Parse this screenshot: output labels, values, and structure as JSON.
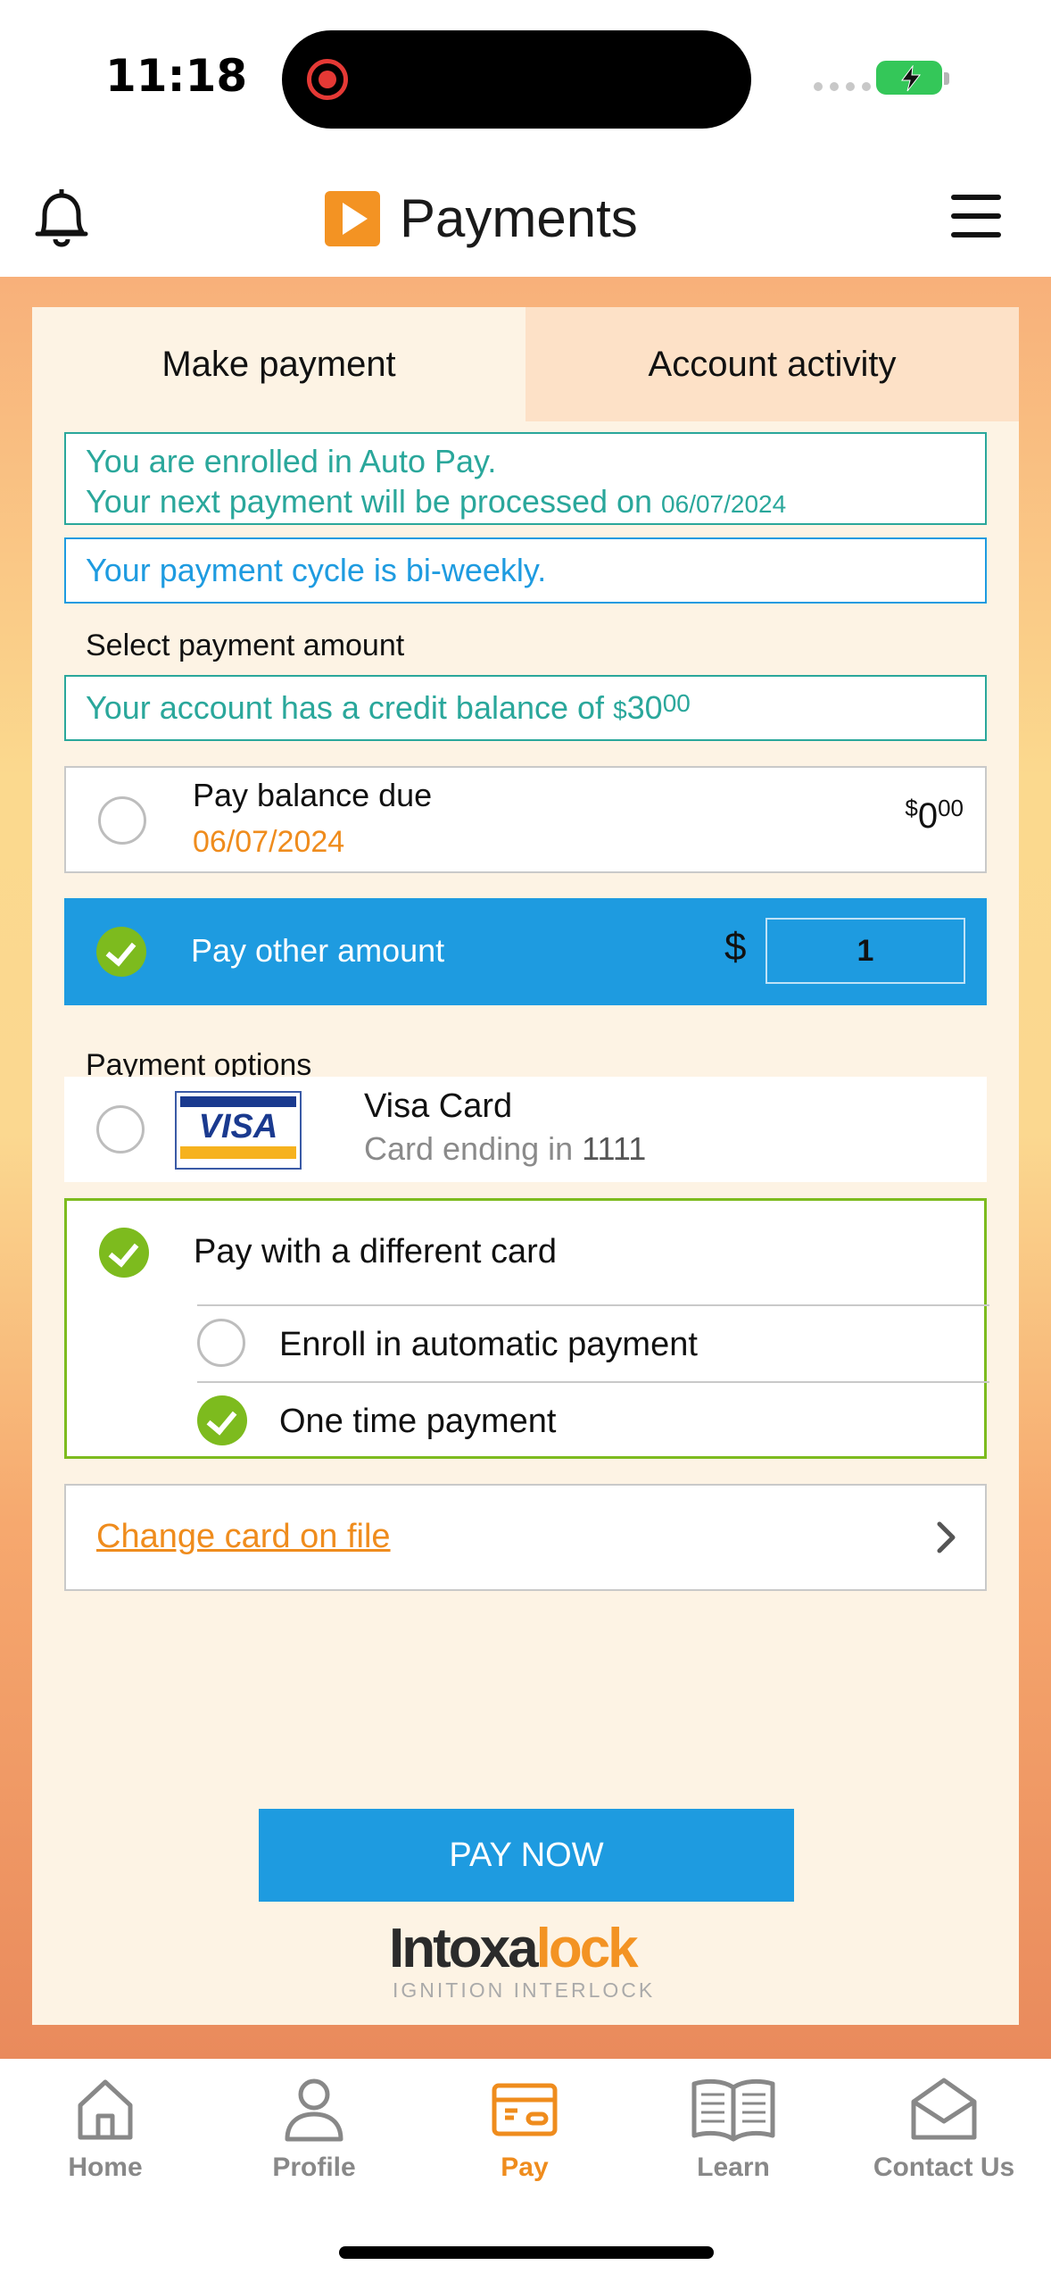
{
  "status_bar": {
    "time": "11:18"
  },
  "header": {
    "title": "Payments"
  },
  "tabs": [
    {
      "label": "Make payment",
      "active": true
    },
    {
      "label": "Account activity",
      "active": false
    }
  ],
  "notices": {
    "autopay_line1": "You are enrolled in Auto Pay.",
    "autopay_line2_prefix": "Your next payment will be processed on ",
    "autopay_date": "06/07/2024",
    "cycle": "Your payment cycle is bi-weekly.",
    "credit_prefix": "Your account has a credit balance of ",
    "credit_currency": "$",
    "credit_dollars": "30",
    "credit_cents": "00"
  },
  "select_amount_label": "Select payment amount",
  "pay_balance": {
    "label": "Pay balance due",
    "date": "06/07/2024",
    "currency": "$",
    "dollars": "0",
    "cents": "00"
  },
  "pay_other": {
    "label": "Pay other amount",
    "currency": "$",
    "value": "1"
  },
  "payment_options_label": "Payment options",
  "visa": {
    "logo_text": "VISA",
    "name": "Visa Card",
    "ending_prefix": "Card ending in ",
    "ending_digits": "1111"
  },
  "different_card": {
    "label": "Pay with a different card",
    "enroll_label": "Enroll in automatic payment",
    "one_time_label": "One time payment"
  },
  "change_card_label": "Change card on file",
  "pay_now_label": "PAY NOW",
  "brand": {
    "dark": "Intoxa",
    "orange": "lock",
    "tagline": "IGNITION INTERLOCK"
  },
  "nav": [
    {
      "label": "Home",
      "icon": "home-icon"
    },
    {
      "label": "Profile",
      "icon": "profile-icon"
    },
    {
      "label": "Pay",
      "icon": "card-icon",
      "active": true
    },
    {
      "label": "Learn",
      "icon": "book-icon"
    },
    {
      "label": "Contact Us",
      "icon": "envelope-icon"
    }
  ],
  "colors": {
    "accent_blue": "#1e9be0",
    "accent_orange": "#ef8c1d",
    "check_green": "#7dbb1e",
    "notice_teal": "#2aa79b"
  }
}
